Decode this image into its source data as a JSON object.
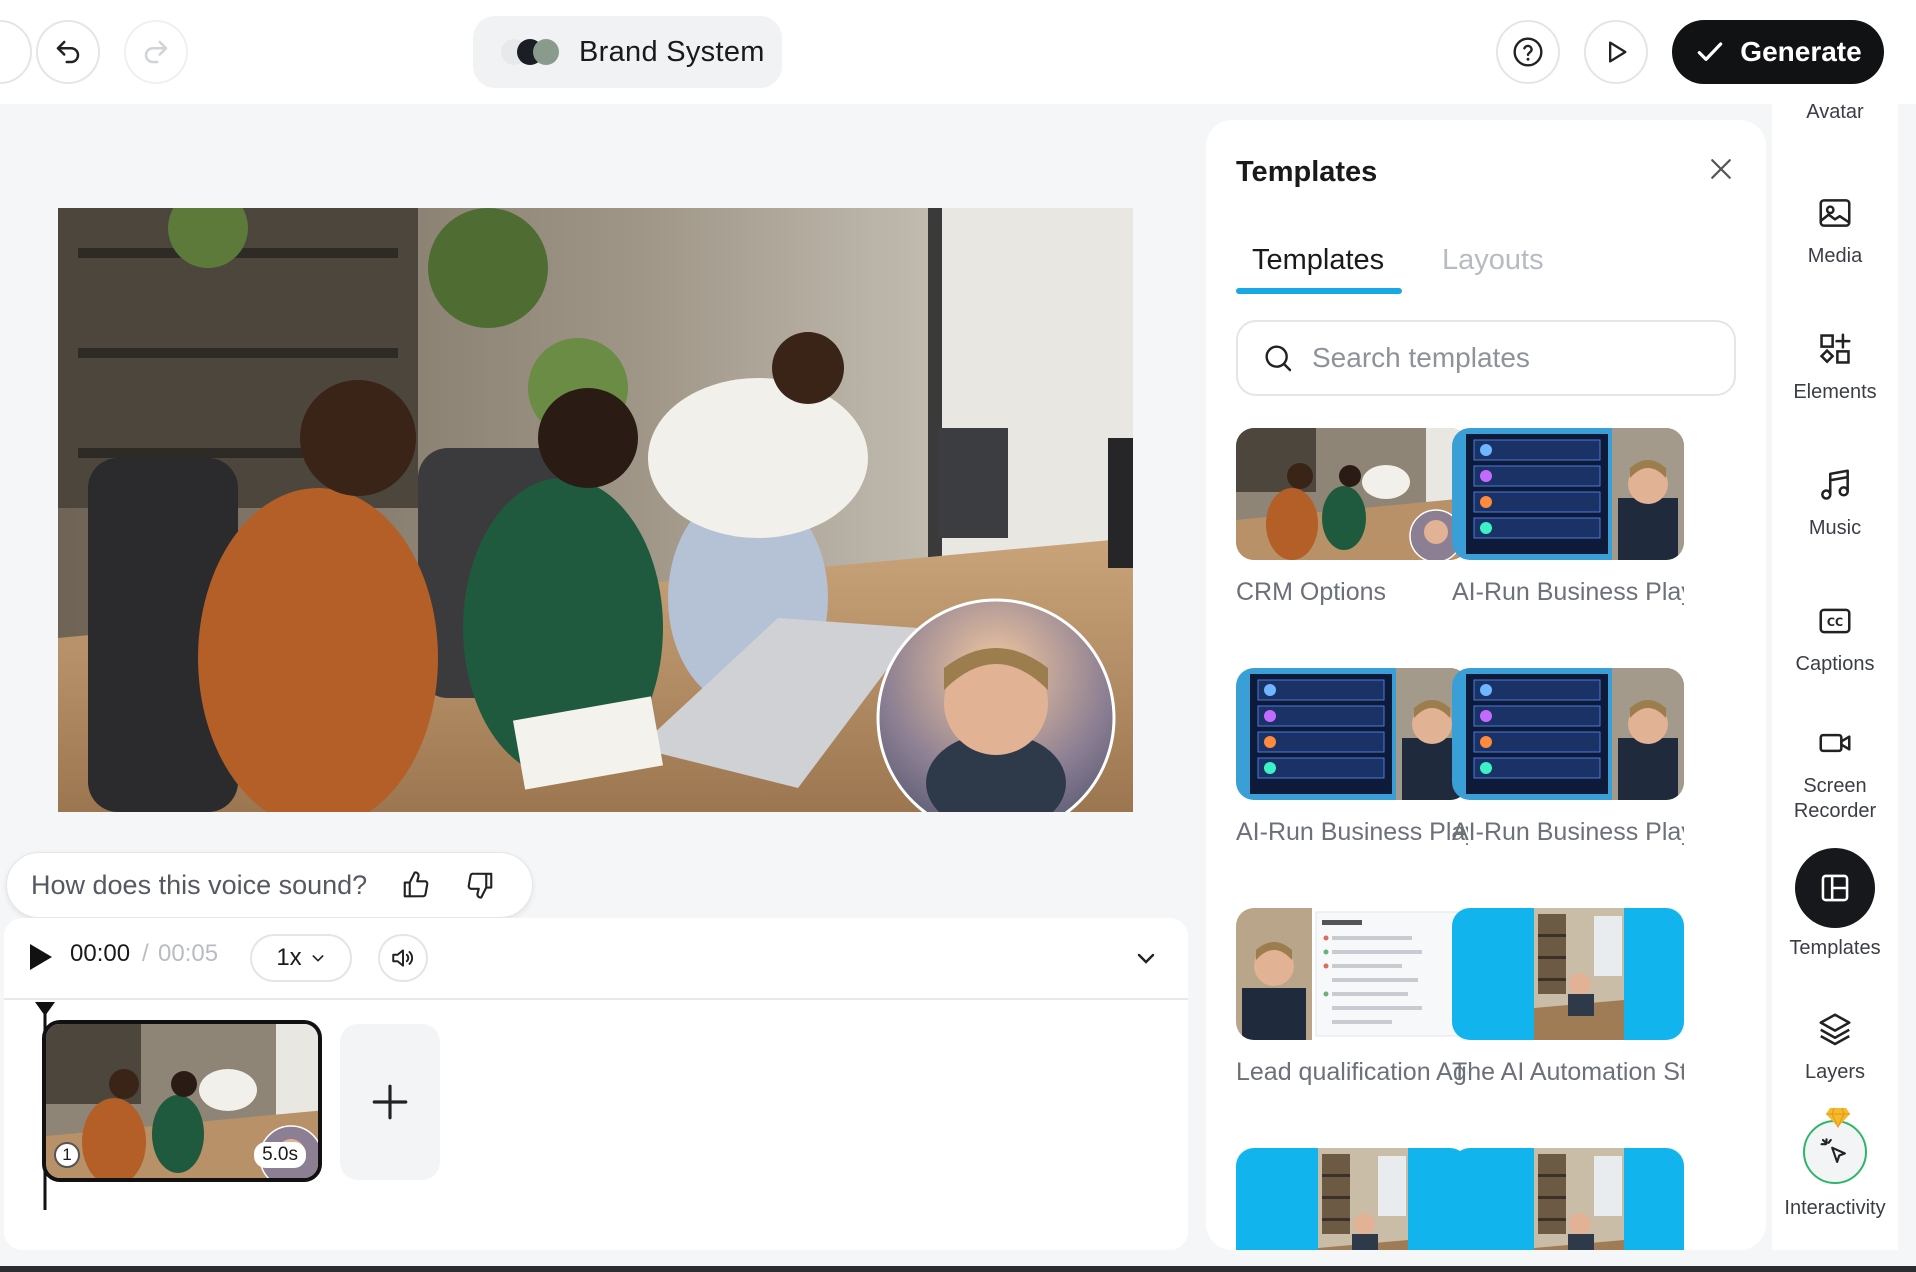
{
  "topbar": {
    "brand_label": "Brand System",
    "generate_label": "Generate"
  },
  "voice_feedback": {
    "question": "How does this voice sound?"
  },
  "timeline": {
    "current_time": "00:00",
    "separator": "/",
    "total_time": "00:05",
    "speed": "1x",
    "clip": {
      "number": "1",
      "duration": "5.0s"
    }
  },
  "templates_panel": {
    "title": "Templates",
    "tabs": [
      "Templates",
      "Layouts"
    ],
    "active_tab": "Templates",
    "search_placeholder": "Search templates",
    "cards": [
      {
        "label": "CRM Options",
        "thumb": "office"
      },
      {
        "label": "AI-Run Business Playbook",
        "thumb": "infographic"
      },
      {
        "label": "AI-Run Business Playbook",
        "thumb": "infographic"
      },
      {
        "label": "AI-Run Business Playbook",
        "thumb": "infographic"
      },
      {
        "label": "Lead qualification Agent",
        "thumb": "list"
      },
      {
        "label": "The AI Automation Studio",
        "thumb": "blue"
      },
      {
        "label": "",
        "thumb": "blue"
      },
      {
        "label": "",
        "thumb": "blue"
      }
    ]
  },
  "sidebar": {
    "items": [
      {
        "label": "Avatar",
        "icon": "avatar-icon"
      },
      {
        "label": "Media",
        "icon": "image-icon"
      },
      {
        "label": "Elements",
        "icon": "shapes-icon"
      },
      {
        "label": "Music",
        "icon": "music-note-icon"
      },
      {
        "label": "Captions",
        "icon": "cc-icon"
      },
      {
        "label": "Screen Recorder",
        "icon": "camera-icon"
      },
      {
        "label": "Templates",
        "icon": "layout-icon",
        "active": true
      },
      {
        "label": "Layers",
        "icon": "layers-icon"
      },
      {
        "label": "Interactivity",
        "icon": "cursor-click-icon"
      }
    ]
  },
  "colors": {
    "accent": "#18a8e6",
    "dark": "#111214",
    "premium_gem": "#f5b82e",
    "template_blue": "#12b4ee"
  }
}
